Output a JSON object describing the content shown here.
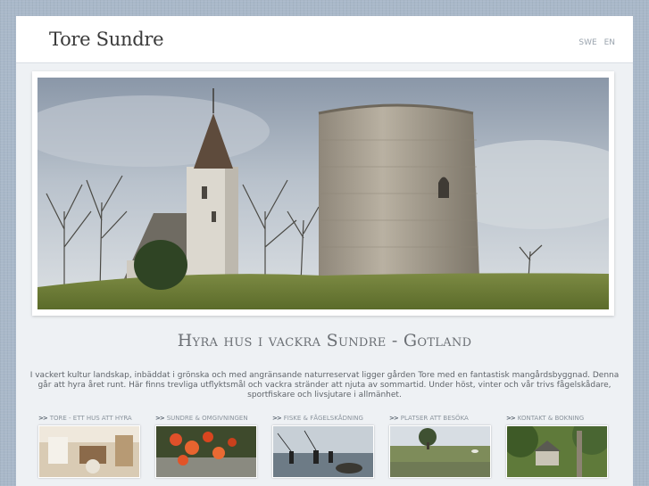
{
  "header": {
    "logo": "Tore Sundre",
    "languages": [
      "SWE",
      "EN"
    ]
  },
  "hero": {
    "image_alt": "church-and-stone-tower-photo"
  },
  "main": {
    "title": "Hyra hus i vackra Sundre - Gotland",
    "intro": "I vackert kultur landskap, inbäddat i grönska och med angränsande naturreservat ligger gården Tore med en fantastisk mangårdsbyggnad. Denna går att hyra året runt. Här finns trevliga utflyktsmål och vackra stränder att njuta av sommartid. Under höst, vinter och vår trivs fågelskådare, sportfiskare och livsjutare i allmänhet."
  },
  "nav": [
    {
      "arrow": ">>",
      "label": "Tore - ett hus att hyra"
    },
    {
      "arrow": ">>",
      "label": "Sundre & omgivningen"
    },
    {
      "arrow": ">>",
      "label": "Fiske & fågelskådning"
    },
    {
      "arrow": ">>",
      "label": "Platser att besöka"
    },
    {
      "arrow": ">>",
      "label": "Kontakt & bokning"
    }
  ],
  "colors": {
    "background": "#a9b8c9",
    "page": "#eef1f4",
    "text": "#5f646a"
  }
}
